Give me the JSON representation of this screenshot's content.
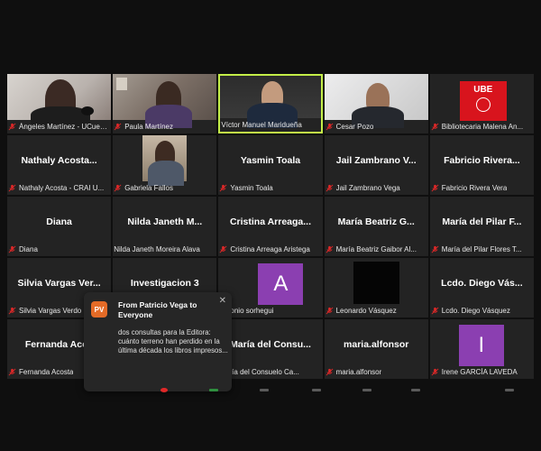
{
  "tiles": [
    {
      "label": "Ángeles Martínez - UCuenc...",
      "muted": true
    },
    {
      "label": "Paula Martínez",
      "muted": true
    },
    {
      "label": "Víctor Manuel Maridueña",
      "muted": false
    },
    {
      "label": "Cesar Pozo",
      "muted": true
    },
    {
      "label": "Bibliotecaria Malena An...",
      "muted": true,
      "logo": "UBE"
    },
    {
      "big": "Nathaly Acosta...",
      "label": "Nathaly Acosta - CRAI U...",
      "muted": true
    },
    {
      "label": "Gabriela Fallos",
      "muted": true
    },
    {
      "big": "Yasmin Toala",
      "label": "Yasmin Toala",
      "muted": true
    },
    {
      "big": "Jail Zambrano V...",
      "label": "Jail Zambrano Vega",
      "muted": true
    },
    {
      "big": "Fabricio Rivera...",
      "label": "Fabricio Rivera Vera",
      "muted": true
    },
    {
      "big": "Diana",
      "label": "Diana",
      "muted": true
    },
    {
      "big": "Nilda Janeth M...",
      "label": "Nilda Janeth Moreira Alava",
      "muted": false
    },
    {
      "big": "Cristina Arreaga...",
      "label": "Cristina Arreaga Aristega",
      "muted": true
    },
    {
      "big": "María Beatriz G...",
      "label": "María Beatriz Gaibor Al...",
      "muted": true
    },
    {
      "big": "María del Pilar F...",
      "label": "María del Pilar Flores T...",
      "muted": true
    },
    {
      "big": "Silvia Vargas Ver...",
      "label": "Silvia Vargas Verdo",
      "muted": true
    },
    {
      "big": "Investigacion 3",
      "label": "",
      "muted": false
    },
    {
      "avatar": "A",
      "label": "Antonio sorhegui",
      "muted": false
    },
    {
      "label": "Leonardo Vásquez",
      "muted": true
    },
    {
      "big": "Lcdo. Diego Vás...",
      "label": "Lcdo. Diego Vásquez",
      "muted": true
    },
    {
      "big": "Fernanda Acos",
      "label": "Fernanda Acosta",
      "muted": true
    },
    {
      "big": "",
      "label": "",
      "muted": false
    },
    {
      "big": "María del Consu...",
      "label": "María del Consuelo Ca...",
      "muted": false
    },
    {
      "big": "maria.alfonsor",
      "label": "maria.alfonsor",
      "muted": true
    },
    {
      "avatar": "I",
      "label": "Irene GARCÍA LAVEDA",
      "muted": true
    }
  ],
  "colors": {
    "active_border": "#c4ee48",
    "muted_icon": "#e02828",
    "avatar_A": "#8b3fb1",
    "avatar_I": "#8b3fb1",
    "pv_badge": "#e46b27"
  },
  "chat_toast": {
    "initials": "PV",
    "title_line1": "From Patricio Vega to",
    "title_line2": "Everyone",
    "message": "dos consultas para la Editora: cuánto terreno han perdido en la última década los libros impresos..."
  }
}
